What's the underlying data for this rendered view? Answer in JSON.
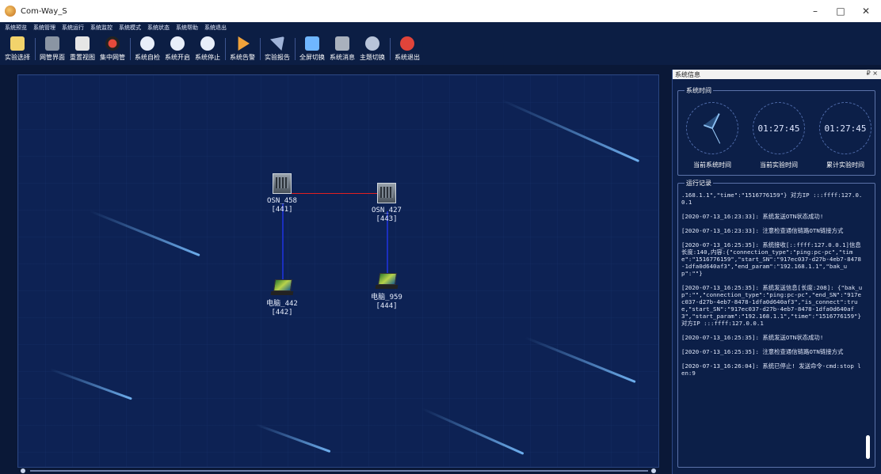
{
  "window": {
    "title": "Com-Way_S",
    "minimize": "–",
    "maximize": "□",
    "close": "✕"
  },
  "menu": [
    "系统预览",
    "系统管理",
    "系统运行",
    "系统监控",
    "系统模式",
    "系统状态",
    "系统帮助",
    "系统退出"
  ],
  "toolbar": [
    {
      "label": "实验选择",
      "icon": "clipboard-icon",
      "color": "#f2d36b"
    },
    {
      "label": "网管界面",
      "icon": "monitor-icon",
      "color": "#8a95a3"
    },
    {
      "label": "重置视图",
      "icon": "reset-view-icon",
      "color": "#e6e6e6"
    },
    {
      "label": "集中网管",
      "icon": "record-icon",
      "color": "#e64a3b"
    },
    {
      "label": "系统自检",
      "icon": "self-check-icon",
      "color": "#e8eef9"
    },
    {
      "label": "系统开启",
      "icon": "play-icon",
      "color": "#e8eef9"
    },
    {
      "label": "系统停止",
      "icon": "pause-icon",
      "color": "#e8eef9"
    },
    {
      "label": "系统告警",
      "icon": "alarm-icon",
      "color": "#f0a23a"
    },
    {
      "label": "实验报告",
      "icon": "report-icon",
      "color": "#9fb3d8"
    },
    {
      "label": "全屏切换",
      "icon": "fullscreen-icon",
      "color": "#6fb6ff"
    },
    {
      "label": "系统消息",
      "icon": "message-icon",
      "color": "#a9b1bd"
    },
    {
      "label": "主题切换",
      "icon": "theme-icon",
      "color": "#b8c4d9"
    },
    {
      "label": "系统退出",
      "icon": "exit-icon",
      "color": "#e0443a"
    }
  ],
  "topology": {
    "nodes": [
      {
        "id": "osn458",
        "name": "OSN_458",
        "code": "[441]",
        "kind": "server"
      },
      {
        "id": "osn427",
        "name": "OSN_427",
        "code": "[443]",
        "kind": "server"
      },
      {
        "id": "pc442",
        "name": "电脑_442",
        "code": "[442]",
        "kind": "laptop"
      },
      {
        "id": "pc959",
        "name": "电脑_959",
        "code": "[444]",
        "kind": "laptop"
      }
    ],
    "link_colors": {
      "optical": "#e02020",
      "access": "#1a2fc0"
    }
  },
  "panel": {
    "title": "系统信息",
    "controls": "₽ ×",
    "clock_group": "系统时间",
    "clocks": [
      {
        "label": "当前系统时间",
        "time": ""
      },
      {
        "label": "当前实验时间",
        "time": "01:27:45"
      },
      {
        "label": "累计实验时间",
        "time": "01:27:45"
      }
    ],
    "log_group": "运行记录",
    "log": [
      ".168.1.1\",\"time\":\"1516776159\"} 对方IP :::ffff:127.0.0.1",
      "[2020-07-13_16:23:33]: 系统发送OTN状态成功!",
      "[2020-07-13_16:23:33]: 注意检查通信链路OTN链接方式",
      "[2020-07-13_16:25:35]: 系统接收[::ffff:127.0.0.1]信息长度:140,内容:{\"connection_type\":\"ping:pc-pc\",\"time\":\"1516776159\",\"start_SN\":\"917ec037-d27b-4eb7-8478-1dfa0d640af3\",\"end_param\":\"192.168.1.1\",\"bak_up\":\"\"}",
      "[2020-07-13_16:25:35]: 系统发送信息[长度:208]: {\"bak_up\":\"\",\"connection_type\":\"ping:pc-pc\",\"end_SN\":\"917ec037-d27b-4eb7-8478-1dfa0d640af3\",\"is_connect\":true,\"start_SN\":\"917ec037-d27b-4eb7-8478-1dfa0d640af3\",\"start_param\":\"192.168.1.1\",\"time\":\"1516776159\"} 对方IP :::ffff:127.0.0.1",
      "[2020-07-13_16:25:35]: 系统发送OTN状态成功!",
      "[2020-07-13_16:25:35]: 注意检查通信链路OTN链接方式",
      "[2020-07-13_16:26:04]: 系统已停止! 发送命令-cmd:stop len:9"
    ]
  }
}
